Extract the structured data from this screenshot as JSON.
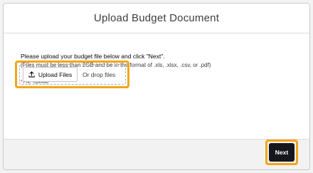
{
  "modal": {
    "title": "Upload Budget Document",
    "instruction": "Please upload your budget file below and click \"Next\".",
    "note": "(Files must be less than 2GB and be in the format of .xls, .xlsx, .csv, or .pdf)",
    "field_label": "File Upload",
    "required_marker": "*",
    "upload_button_label": "Upload Files",
    "upload_icon": "upload-icon",
    "drop_text": "Or drop files",
    "next_label": "Next"
  },
  "colors": {
    "highlight": "#f2a51a",
    "primary_button": "#16161d",
    "required": "#c23934"
  }
}
